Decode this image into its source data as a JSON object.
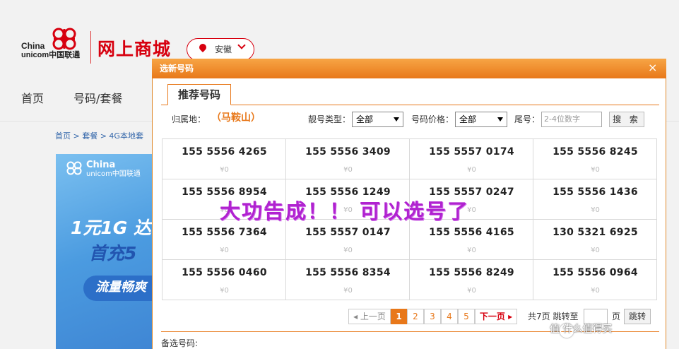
{
  "header": {
    "logo_china": "China",
    "logo_unicom": "unicom中国联通",
    "mall_title": "网上商城",
    "region": "安徽"
  },
  "nav": {
    "items": [
      "首页",
      "号码/套餐"
    ]
  },
  "breadcrumb": "首页 > 套餐 > 4G本地套",
  "banner": {
    "china": "China",
    "unicom": "unicom中国联通",
    "line1": "1元1G 达",
    "line2": "首充5",
    "line3": "流量畅爽"
  },
  "dialog": {
    "title": "选新号码",
    "close": "×",
    "tab": "推荐号码",
    "filters": {
      "location_label": "归属地：",
      "location_value": "（马鞍山）",
      "type_label": "靓号类型：",
      "type_value": "全部",
      "price_label": "号码价格：",
      "price_value": "全部",
      "tail_label": "尾号：",
      "tail_placeholder": "2-4位数字",
      "search": "搜 索"
    },
    "numbers": [
      {
        "number": "155 5556 4265",
        "price": "¥0"
      },
      {
        "number": "155 5556 3409",
        "price": "¥0"
      },
      {
        "number": "155 5557 0174",
        "price": "¥0"
      },
      {
        "number": "155 5556 8245",
        "price": "¥0"
      },
      {
        "number": "155 5556 8954",
        "price": "¥0"
      },
      {
        "number": "155 5556 1249",
        "price": "¥0"
      },
      {
        "number": "155 5557 0247",
        "price": "¥0"
      },
      {
        "number": "155 5556 1436",
        "price": "¥0"
      },
      {
        "number": "155 5556 7364",
        "price": "¥0"
      },
      {
        "number": "155 5557 0147",
        "price": "¥0"
      },
      {
        "number": "155 5556 4165",
        "price": "¥0"
      },
      {
        "number": "130 5321 6925",
        "price": "¥0"
      },
      {
        "number": "155 5556 0460",
        "price": "¥0"
      },
      {
        "number": "155 5556 8354",
        "price": "¥0"
      },
      {
        "number": "155 5556 8249",
        "price": "¥0"
      },
      {
        "number": "155 5556 0964",
        "price": "¥0"
      }
    ],
    "overlay_text": "大功告成！！ 可以选号了",
    "pagination": {
      "prev": "◂ 上一页",
      "pages": [
        "1",
        "2",
        "3",
        "4",
        "5"
      ],
      "next": "下一页 ▸",
      "total": "共7页 跳转至",
      "unit": "页",
      "go": "跳转"
    },
    "backup_label": "备选号码:"
  },
  "watermark": "值 什么值得买",
  "colors": {
    "brand_red": "#d7000f",
    "accent_orange": "#e8781a",
    "overlay_purple": "#b022d0"
  }
}
